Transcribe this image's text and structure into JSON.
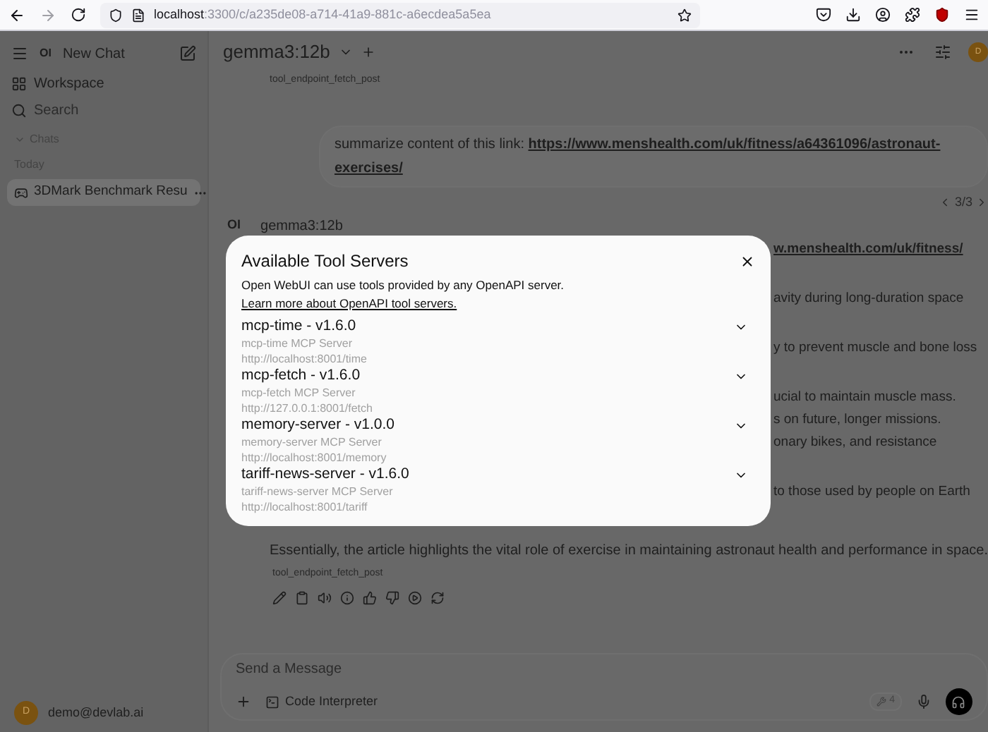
{
  "browser": {
    "url_host": "localhost",
    "url_path": ":3300/c/a235de08-a714-41a9-881c-a6ecdea5a5ea"
  },
  "sidebar": {
    "logo": "OI",
    "new_chat": "New Chat",
    "workspace": "Workspace",
    "search_placeholder": "Search",
    "section": "Chats",
    "group": "Today",
    "items": [
      {
        "title": "3DMark Benchmark Resu",
        "selected": true
      }
    ],
    "user": {
      "initial": "D",
      "email": "demo@devlab.ai"
    }
  },
  "header": {
    "model": "gemma3:12b",
    "avatar": "D"
  },
  "chat": {
    "tool_top": "tool_endpoint_fetch_post",
    "user_message": {
      "text": "summarize content of this link: ",
      "link_lines": [
        "https://www.menshealth.com/uk/fitness/a64361096/astronaut-",
        "exercises/"
      ]
    },
    "pager": "3/3",
    "assistant": {
      "logo": "OI",
      "model": "gemma3:12b",
      "paragraphs": [
        [
          {
            "text": "w.menshealth.com/uk/fitness/",
            "link": true
          }
        ],
        [
          {
            "text": "avity during long-duration space",
            "link": false
          }
        ],
        [
          {
            "text": "y to prevent muscle and bone loss",
            "link": false
          }
        ],
        [
          {
            "text": "ucial to maintain muscle mass.",
            "link": false
          },
          {
            "text": "s on future, longer missions.",
            "link": false
          },
          {
            "text": "onary bikes, and resistance",
            "link": false
          }
        ],
        [
          {
            "text": "to those used by people on Earth",
            "link": false
          }
        ]
      ],
      "summary": "Essentially, the article highlights the vital role of exercise in maintaining astronaut health and performance in space.",
      "tool": "tool_endpoint_fetch_post"
    }
  },
  "input": {
    "placeholder": "Send a Message",
    "code_interpreter": "Code Interpreter",
    "tools_count": "4"
  },
  "modal": {
    "title": "Available Tool Servers",
    "description": "Open WebUI can use tools provided by any OpenAPI server.",
    "link": "Learn more about OpenAPI tool servers.",
    "servers": [
      {
        "name": "mcp-time - v1.6.0",
        "description": "mcp-time MCP Server",
        "url": "http://localhost:8001/time",
        "expanded": false
      },
      {
        "name": "mcp-fetch - v1.6.0",
        "description": "mcp-fetch MCP Server",
        "url": "http://127.0.0.1:8001/fetch",
        "expanded": false
      },
      {
        "name": "memory-server - v1.0.0",
        "description": "memory-server MCP Server",
        "url": "http://localhost:8001/memory",
        "expanded": false
      },
      {
        "name": "tariff-news-server - v1.6.0",
        "description": "tariff-news-server MCP Server",
        "url": "http://localhost:8001/tariff",
        "expanded": false
      }
    ]
  }
}
